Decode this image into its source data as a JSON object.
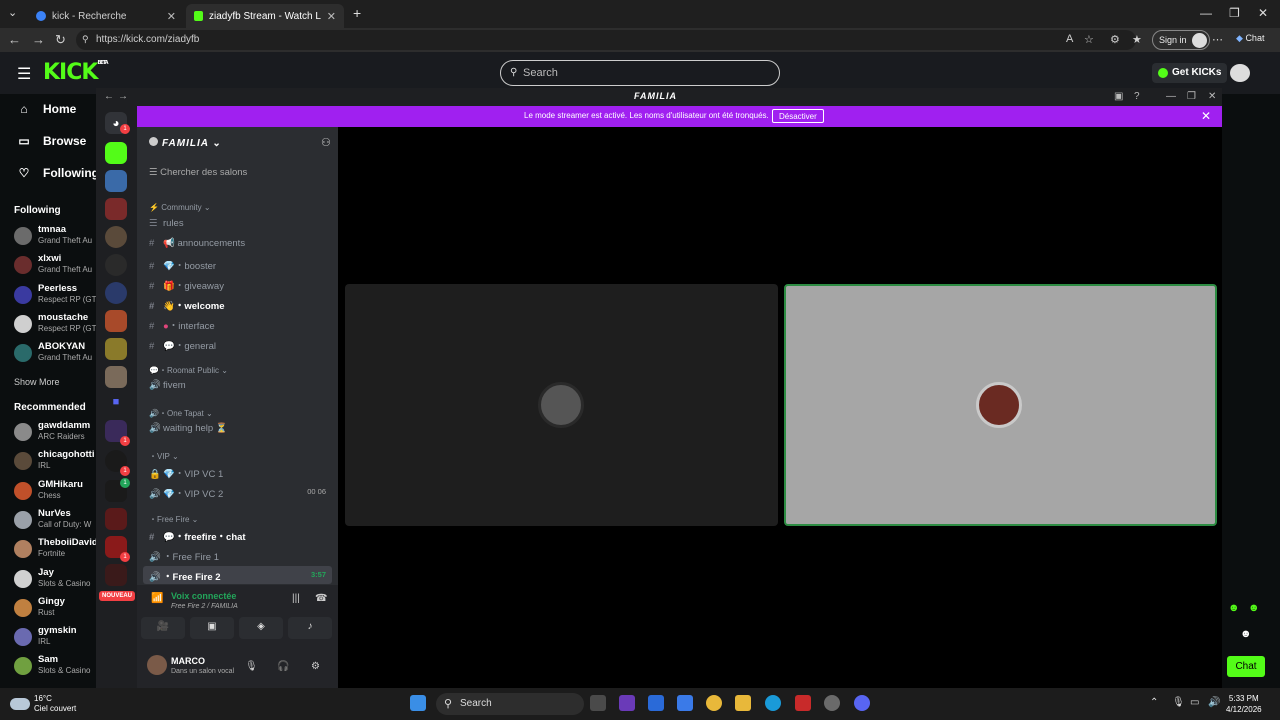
{
  "browser": {
    "tabs": [
      {
        "label": "kick - Recherche"
      },
      {
        "label": "ziadyfb Stream - Watch Live on Ki"
      }
    ],
    "url": "https://kick.com/ziadyfb",
    "signin": "Sign in",
    "copilot": "Chat"
  },
  "kick": {
    "logo": "KICK",
    "logo_badge": "BETA",
    "search_placeholder": "Search",
    "get_kicks": "Get KICKs",
    "nav": [
      {
        "label": "Home"
      },
      {
        "label": "Browse"
      },
      {
        "label": "Following"
      }
    ],
    "following_title": "Following",
    "following": [
      {
        "name": "tmnaa",
        "category": "Grand Theft Au",
        "color": "#6b6b6b"
      },
      {
        "name": "xlxwi",
        "category": "Grand Theft Au",
        "color": "#6a2d2d"
      },
      {
        "name": "Peerless",
        "category": "Respect RP (GT",
        "color": "#3a3aa0"
      },
      {
        "name": "moustache",
        "category": "Respect RP (GT",
        "color": "#cfcfcf"
      },
      {
        "name": "ABOKYAN",
        "category": "Grand Theft Au",
        "color": "#2a6a6a"
      }
    ],
    "show_more": "Show More",
    "recommended_title": "Recommended",
    "recommended": [
      {
        "name": "gawddamm",
        "category": "ARC Raiders",
        "color": "#8a8a8a"
      },
      {
        "name": "chicagohotti",
        "category": "IRL",
        "color": "#5a4a3a"
      },
      {
        "name": "GMHikaru",
        "category": "Chess",
        "color": "#c0502a"
      },
      {
        "name": "NurVes",
        "category": "Call of Duty: W",
        "color": "#9aa0a8"
      },
      {
        "name": "TheboiiDavid",
        "category": "Fortnite",
        "color": "#b08060"
      },
      {
        "name": "Jay",
        "category": "Slots & Casino",
        "color": "#d0d0d0"
      },
      {
        "name": "Gingy",
        "category": "Rust",
        "color": "#c08040"
      },
      {
        "name": "gymskin",
        "category": "IRL",
        "color": "#6a6ab0"
      },
      {
        "name": "Sam",
        "category": "Slots & Casino",
        "color": "#70a040"
      }
    ],
    "chat_button": "Chat"
  },
  "discord": {
    "title": "FAMILIA",
    "streamer_msg": "Le mode streamer est activé. Les noms d'utilisateur ont été tronqués.",
    "streamer_btn": "Désactiver",
    "server_name": "FAMILIA",
    "channel_search": "Chercher des salons",
    "categories": [
      {
        "label": "Community"
      },
      {
        "label": "Roomat Public"
      },
      {
        "label": "One Tapat"
      },
      {
        "label": "VIP"
      },
      {
        "label": "Free Fire"
      }
    ],
    "channels": [
      {
        "label": "rules"
      },
      {
        "label": "announcements"
      },
      {
        "label": "booster"
      },
      {
        "label": "giveaway"
      },
      {
        "label": "welcome"
      },
      {
        "label": "interface"
      },
      {
        "label": "general"
      },
      {
        "label": "fivem"
      },
      {
        "label": "waiting help ⏳"
      },
      {
        "label": "VIP VC 1"
      },
      {
        "label": "VIP VC 2",
        "extra": "00  06"
      },
      {
        "label": "freefire・chat"
      },
      {
        "label": "Free Fire 1"
      },
      {
        "label": "Free Fire 2",
        "extra": "3:57"
      }
    ],
    "nouveau": "NOUVEAU",
    "voice_title": "Voix connectée",
    "voice_sub": "Free Fire 2 / FAMILIA",
    "user_name": "MARCO",
    "user_status": "Dans un salon vocal"
  },
  "taskbar": {
    "weather_temp": "16°C",
    "weather_desc": "Ciel couvert",
    "search": "Search",
    "time": "5:33 PM",
    "date": "4/12/2026"
  }
}
